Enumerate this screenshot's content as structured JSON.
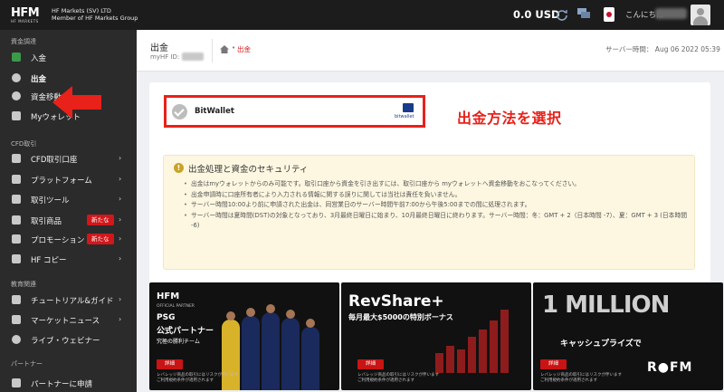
{
  "topbar": {
    "logo_mark": "HFM",
    "logo_sub": "HF MARKETS",
    "company_line1": "HF Markets (SV) LTD",
    "company_line2": "Member of HF Markets Group",
    "balance": "0.0 USD",
    "greeting": "こんにちは"
  },
  "sidebar": {
    "section_funding": "資金調達",
    "items_funding": [
      {
        "label": "入金",
        "icon": "deposit-icon"
      },
      {
        "label": "出金",
        "icon": "withdraw-icon"
      },
      {
        "label": "資金移動",
        "icon": "transfer-icon"
      },
      {
        "label": "Myウォレット",
        "icon": "wallet-icon"
      }
    ],
    "section_cfd": "CFD取引",
    "items_cfd": [
      {
        "label": "CFD取引口座",
        "icon": "grid-icon"
      },
      {
        "label": "プラットフォーム",
        "icon": "platform-icon"
      },
      {
        "label": "取引ツール",
        "icon": "tools-icon"
      },
      {
        "label": "取引商品",
        "icon": "products-icon",
        "badge": "新たな"
      },
      {
        "label": "プロモーション",
        "icon": "promo-icon",
        "badge": "新たな"
      },
      {
        "label": "HF コピー",
        "icon": "copy-icon"
      }
    ],
    "section_edu": "教育関連",
    "items_edu": [
      {
        "label": "チュートリアル&ガイド",
        "icon": "tutorial-icon"
      },
      {
        "label": "マーケットニュース",
        "icon": "news-icon"
      },
      {
        "label": "ライブ・ウェビナー",
        "icon": "webinar-icon"
      }
    ],
    "section_partner": "パートナー",
    "items_partner": [
      {
        "label": "パートナーに申請",
        "icon": "partner-icon"
      }
    ]
  },
  "page": {
    "title": "出金",
    "myhf_label": "myHF ID:",
    "breadcrumb_current": "出金",
    "breadcrumb_sep": "•",
    "server_time": "サーバー時間： Aug 06 2022 05:39"
  },
  "method": {
    "name": "BitWallet",
    "logo_text": "bitwallet",
    "annotation": "出金方法を選択"
  },
  "notice": {
    "title": "出金処理と資金のセキュリティ",
    "lines": [
      "出金はmyウォレットからのみ可能です。取引口座から資金を引き出すには、取引口座から myウォレットへ資金移動をおこなってください。",
      "出金申請時に口座所有者により入力される情報に関する誤りに関しては当社は責任を負いません。",
      "サーバー時間10:00より前に申請された出金は、同営業日のサーバー時間午前7:00から午後5:00までの間に処理されます。",
      "サーバー時間は夏時間(DST)の対象となっており、3月最終日曜日に始まり、10月最終日曜日に終わります。サーバー時間：冬：GMT + 2（日本時間 -7）、夏：GMT + 3 (日本時間 -6)"
    ]
  },
  "banners": [
    {
      "title": "PSG",
      "subtitle": "公式パートナー",
      "tagline": "究極の勝利チーム",
      "header": "OFFICIAL PARTNER",
      "button": "詳細",
      "fine": "レバレッジ商品の取引にはリスクが伴います ご利用規約条件が適用されます"
    },
    {
      "title": "RevShare+",
      "subtitle": "毎月最大$5000の特別ボーナス",
      "button": "詳細",
      "fine": "レバレッジ商品の取引にはリスクが伴います ご利用規約条件が適用されます"
    },
    {
      "title": "1 MILLION",
      "subtitle": "キャッシュプライズで",
      "brand": "R●FM",
      "button": "詳細",
      "fine": "レバレッジ商品の取引にはリスクが伴います ご利用規約条件が適用されます"
    }
  ]
}
